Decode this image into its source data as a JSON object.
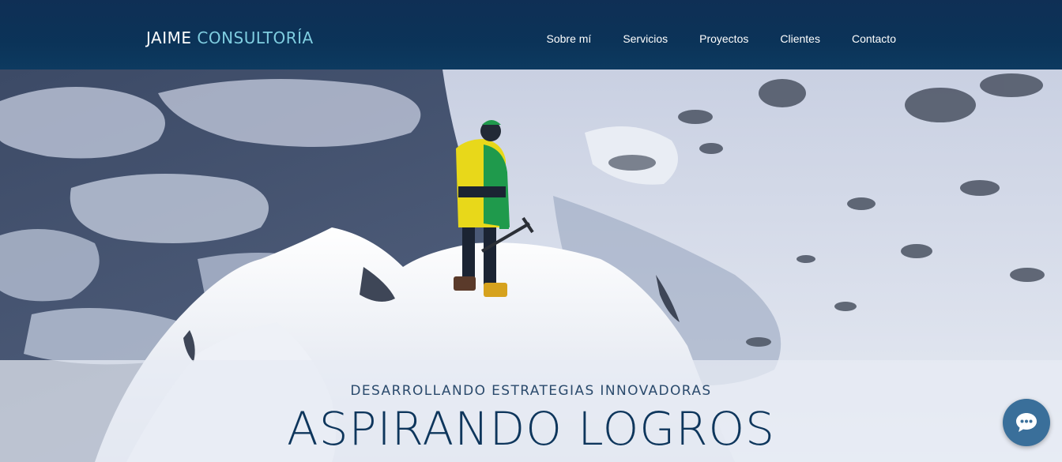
{
  "header": {
    "logo_first": "JAIME",
    "logo_second": "CONSULTORÍA",
    "nav": [
      {
        "label": "Sobre mí"
      },
      {
        "label": "Servicios"
      },
      {
        "label": "Proyectos"
      },
      {
        "label": "Clientes"
      },
      {
        "label": "Contacto"
      }
    ]
  },
  "hero": {
    "subtitle": "DESARROLLANDO ESTRATEGIAS INNOVADORAS",
    "title": "ASPIRANDO LOGROS",
    "image": "mountaineer-on-snowy-summit"
  },
  "chat": {
    "icon": "chat-bubble-icon"
  },
  "colors": {
    "header_bg": "#0b3358",
    "logo_accent": "#7fcde0",
    "title": "#0e365c",
    "chat_button": "#3a6f9a"
  }
}
